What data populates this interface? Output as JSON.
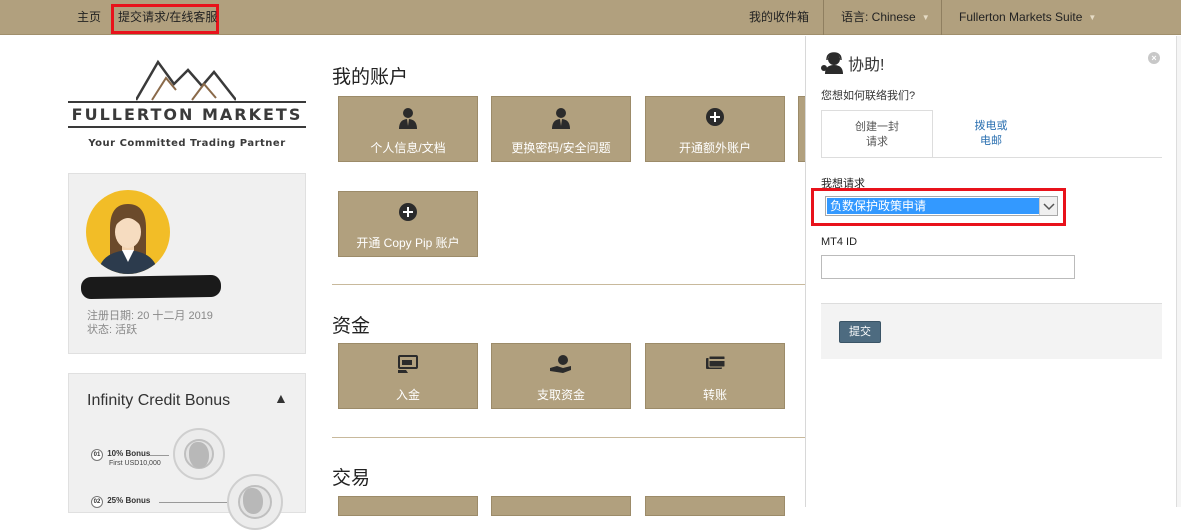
{
  "topbar": {
    "home": "主页",
    "submit_request": "提交请求/在线客服",
    "inbox": "我的收件箱",
    "language": "语言: Chinese",
    "suite": "Fullerton Markets Suite",
    "highlight_color": "#e8121b"
  },
  "logo": {
    "name": "FULLERTON MARKETS",
    "tagline": "Your Committed Trading Partner"
  },
  "profile": {
    "registered": "注册日期: 20 十二月 2019",
    "status": "状态: 活跃"
  },
  "bonus": {
    "title": "Infinity Credit Bonus",
    "tiers": [
      {
        "num": "01",
        "label": "10% Bonus",
        "sub": "First USD10,000"
      },
      {
        "num": "02",
        "label": "25% Bonus"
      }
    ]
  },
  "sections": {
    "account": {
      "title": "我的账户",
      "tiles": [
        {
          "label": "个人信息/文档",
          "icon": "person-icon"
        },
        {
          "label": "更换密码/安全问题",
          "icon": "person-icon"
        },
        {
          "label": "开通额外账户",
          "icon": "plus-circle-icon"
        },
        {
          "label": "开通 Copy Pip 账户",
          "icon": "plus-circle-icon"
        }
      ]
    },
    "funds": {
      "title": "资金",
      "tiles": [
        {
          "label": "入金",
          "icon": "deposit-icon"
        },
        {
          "label": "支取资金",
          "icon": "withdraw-icon"
        },
        {
          "label": "转账",
          "icon": "transfer-icon"
        }
      ]
    },
    "trading": {
      "title": "交易"
    }
  },
  "help": {
    "title": "协助!",
    "question": "您想如何联络我们?",
    "tab_ticket": "创建一封\n请求",
    "tab_ticket_line1": "创建一封",
    "tab_ticket_line2": "请求",
    "tab_call_line1": "拨电或",
    "tab_call_line2": "电邮",
    "request_label": "我想请求",
    "request_value": "负数保护政策申请",
    "mt4_label": "MT4 ID",
    "mt4_value": "",
    "submit_label": "提交"
  },
  "colors": {
    "brand": "#b1a07e",
    "accent_blue": "#2a6fb0",
    "select_highlight": "#3399ff",
    "button": "#4d6b80"
  }
}
